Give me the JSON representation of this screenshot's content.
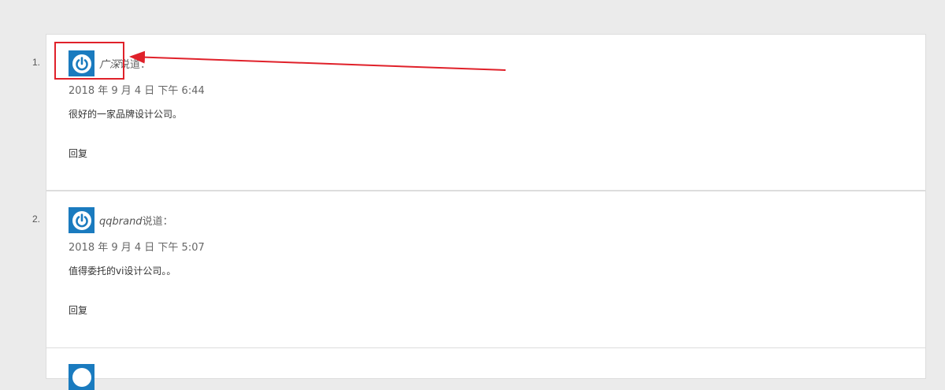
{
  "comments": [
    {
      "number": "1.",
      "author": "广深",
      "said": "说道：",
      "date": "2018 年 9 月 4 日 下午 6:44",
      "text": "很好的一家品牌设计公司。",
      "reply": "回复"
    },
    {
      "number": "2.",
      "author": "qqbrand",
      "said": "说道：",
      "date": "2018 年 9 月 4 日 下午 5:07",
      "text": "值得委托的vi设计公司。。",
      "reply": "回复"
    }
  ],
  "colors": {
    "page_background": "#ebebeb",
    "card_background": "#ffffff",
    "avatar_blue": "#1a7bbf",
    "annotation_red": "#e0212a"
  },
  "icons": {
    "avatar": "power-icon"
  }
}
